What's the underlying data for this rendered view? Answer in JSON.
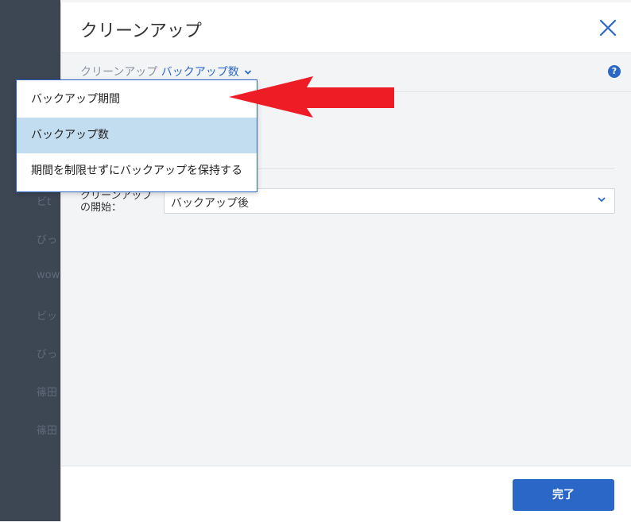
{
  "background_list": [
    "ビt",
    "びっ",
    "wow",
    "ビッ",
    "びっ",
    "篠田",
    "篠田"
  ],
  "dialog": {
    "title": "クリーンアップ",
    "subnav": {
      "static_label": "クリーンアップ",
      "selected_label": "バックアップ数"
    },
    "help_icon": "?",
    "start_label_line1": "クリーンアップ",
    "start_label_line2": "の開始：",
    "start_select_value": "バックアップ後",
    "done_button": "完了"
  },
  "dropdown": {
    "items": [
      {
        "label": "バックアップ期間",
        "selected": false
      },
      {
        "label": "バックアップ数",
        "selected": true
      },
      {
        "label": "期間を制限せずにバックアップを保持する",
        "selected": false
      }
    ]
  },
  "colors": {
    "accent": "#2b67c6",
    "selected_item_bg": "#c3ddf0",
    "annotation_arrow": "#ee1c25"
  }
}
